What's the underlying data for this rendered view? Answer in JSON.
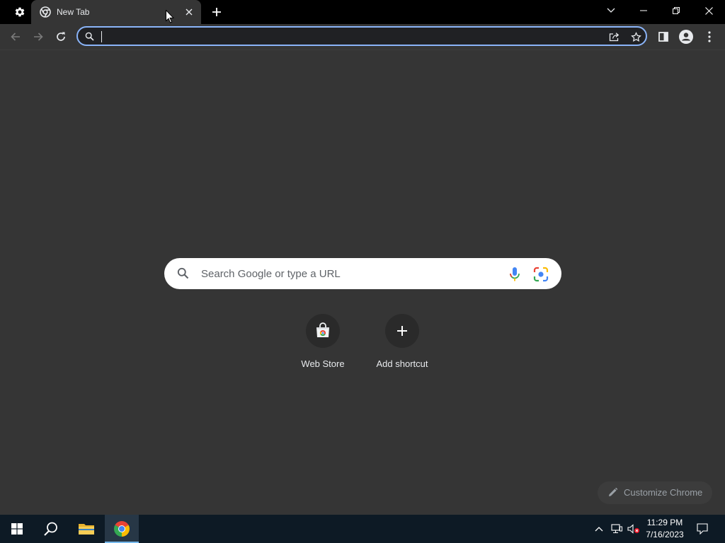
{
  "window": {
    "tab": {
      "title": "New Tab"
    }
  },
  "toolbar": {
    "omnibox": {
      "value": "",
      "placeholder": ""
    }
  },
  "ntp": {
    "search_placeholder": "Search Google or type a URL",
    "shortcuts": [
      {
        "label": "Web Store",
        "icon": "web-store-icon"
      },
      {
        "label": "Add shortcut",
        "icon": "plus-icon"
      }
    ],
    "customize_label": "Customize Chrome"
  },
  "taskbar": {
    "clock_time": "11:29 PM",
    "clock_date": "7/16/2023"
  },
  "colors": {
    "titlebar": "#000000",
    "surface": "#353535",
    "omnibox_focus": "#8ab4f8",
    "taskbar": "#0d1a25"
  }
}
